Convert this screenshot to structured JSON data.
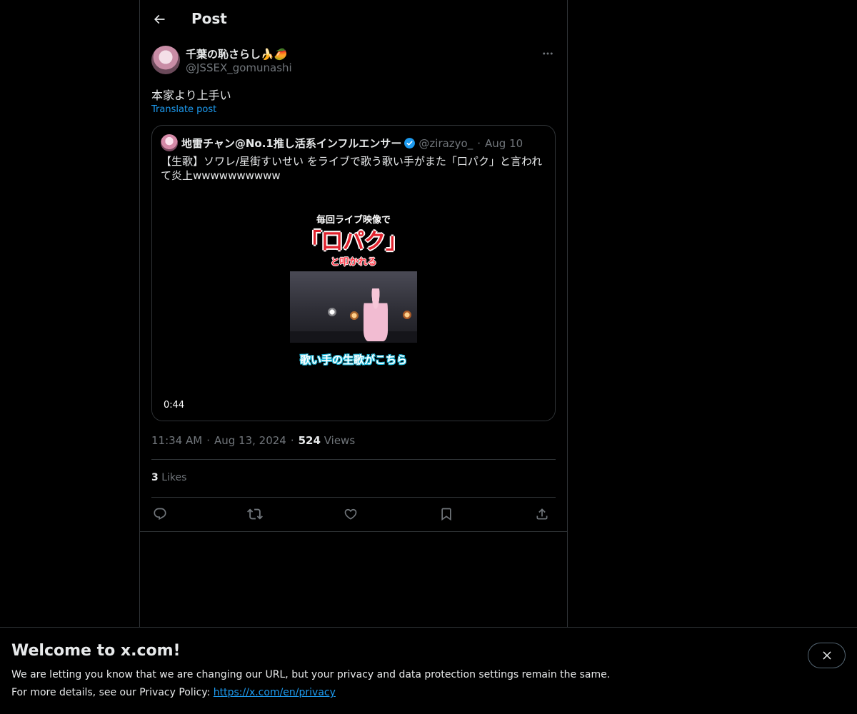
{
  "header": {
    "title": "Post"
  },
  "post": {
    "author_name": "千葉の恥さらし🍌🥭",
    "author_handle": "@JSSEX_gomunashi",
    "text": "本家より上手い",
    "translate_label": "Translate post",
    "quote": {
      "author_name": "地雷チャン@No.1推し活系インフルエンサー",
      "author_handle": "@zirazyo_",
      "dot": "·",
      "date": "Aug 10",
      "text": "【生歌】ソワレ/星街すいせい をライブで歌う歌い手がまた「口パク」と言われて炎上wwwwwwwwww",
      "video": {
        "caption_top": "毎回ライブ映像で",
        "caption_main": "「口パク」",
        "caption_sub": "と叩かれる",
        "caption_bottom": "歌い手の生歌がこちら",
        "duration": "0:44"
      }
    },
    "time": "11:34 AM",
    "date": "Aug 13, 2024",
    "sep": "·",
    "views_count": "524",
    "views_label": "Views",
    "likes_count": "3",
    "likes_label": "Likes"
  },
  "banner": {
    "title": "Welcome to x.com!",
    "line1": "We are letting you know that we are changing our URL, but your privacy and data protection settings remain the same.",
    "line2_prefix": "For more details, see our Privacy Policy: ",
    "link": "https://x.com/en/privacy"
  },
  "icons": {
    "back": "arrow-left-icon",
    "more": "more-horizontal-icon",
    "verified": "verified-badge-icon",
    "reply": "reply-icon",
    "repost": "repost-icon",
    "like": "heart-icon",
    "bookmark": "bookmark-icon",
    "share": "share-icon",
    "close": "close-icon"
  },
  "colors": {
    "background": "#000000",
    "text": "#e7e9ea",
    "muted": "#71767b",
    "accent": "#1d9bf0",
    "border": "#2f3336"
  }
}
